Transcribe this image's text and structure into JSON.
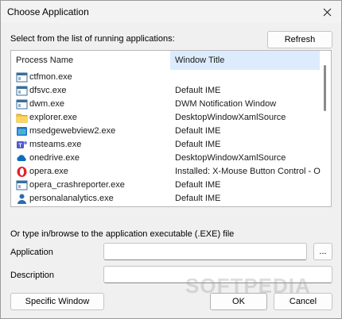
{
  "window": {
    "title": "Choose Application"
  },
  "select_label": "Select from the list of running applications:",
  "refresh_label": "Refresh",
  "columns": {
    "process": "Process Name",
    "window": "Window Title"
  },
  "processes": [
    {
      "name": "ctfmon.exe",
      "window": "",
      "icon": "generic-app-icon"
    },
    {
      "name": "dfsvc.exe",
      "window": "Default IME",
      "icon": "generic-app-icon"
    },
    {
      "name": "dwm.exe",
      "window": "DWM Notification Window",
      "icon": "generic-app-icon"
    },
    {
      "name": "explorer.exe",
      "window": "DesktopWindowXamlSource",
      "icon": "folder-icon"
    },
    {
      "name": "msedgewebview2.exe",
      "window": "Default IME",
      "icon": "edge-webview-icon"
    },
    {
      "name": "msteams.exe",
      "window": "Default IME",
      "icon": "teams-icon"
    },
    {
      "name": "onedrive.exe",
      "window": "DesktopWindowXamlSource",
      "icon": "onedrive-cloud-icon"
    },
    {
      "name": "opera.exe",
      "window": "Installed: X-Mouse Button Control - O",
      "icon": "opera-icon"
    },
    {
      "name": "opera_crashreporter.exe",
      "window": "Default IME",
      "icon": "generic-app-icon"
    },
    {
      "name": "personalanalytics.exe",
      "window": "Default IME",
      "icon": "person-icon"
    }
  ],
  "browse_label": "Or type in/browse to the application executable (.EXE) file",
  "application_label": "Application",
  "application_value": "",
  "browse_button": "...",
  "description_label": "Description",
  "description_value": "",
  "specific_window_button": "Specific Window",
  "ok_button": "OK",
  "cancel_button": "Cancel",
  "watermark": "SOFTPEDIA",
  "colors": {
    "header_highlight": "#dcecfc",
    "background": "#f0f0f0"
  }
}
